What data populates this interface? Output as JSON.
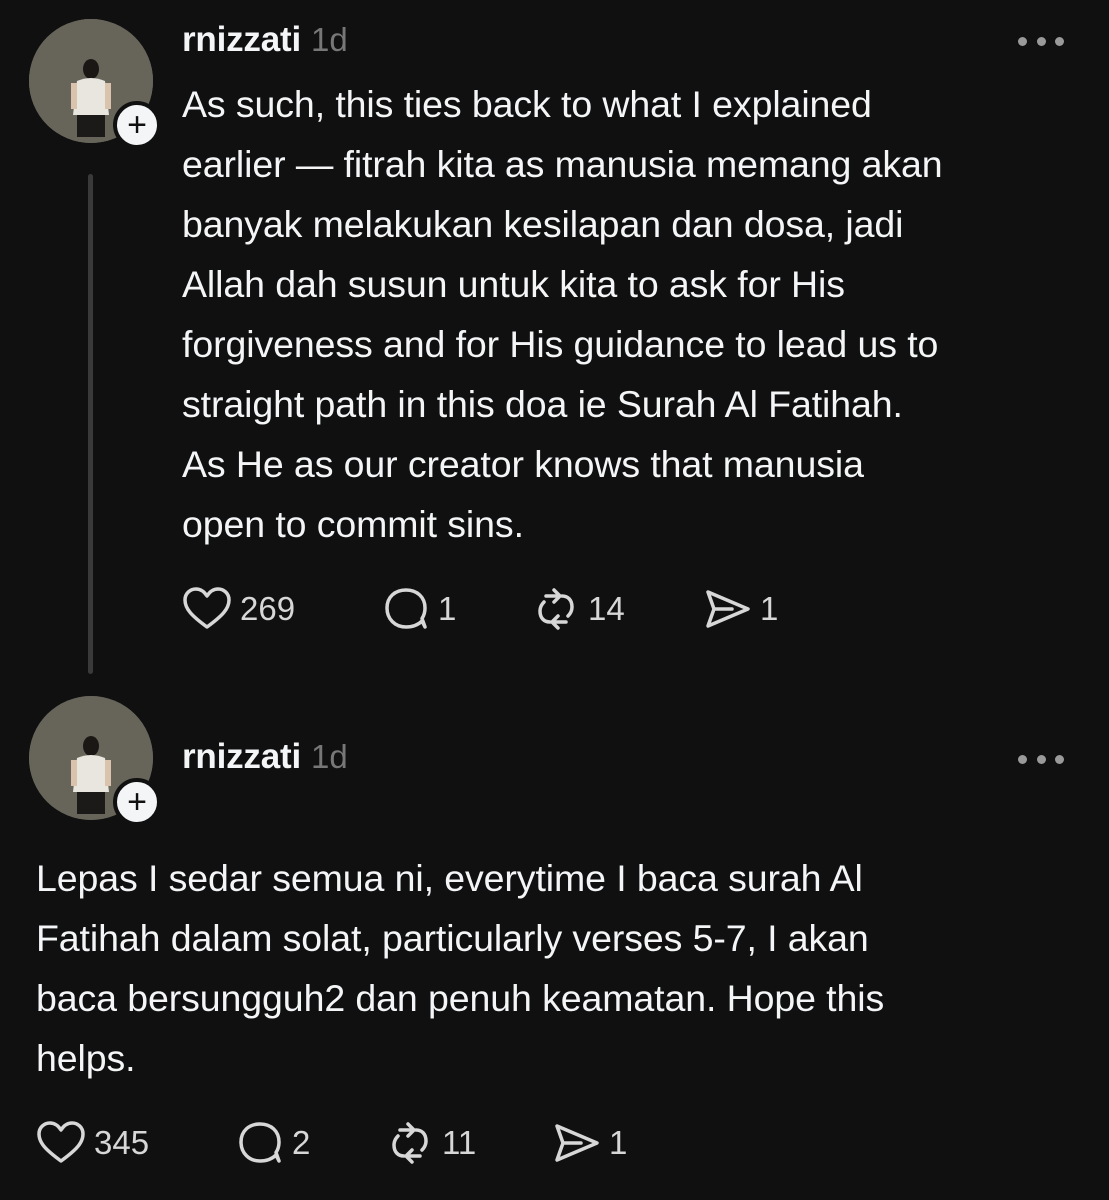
{
  "posts": [
    {
      "username": "rnizzati",
      "time": "1d",
      "text": "As such, this ties back to what I explained\nearlier — fitrah kita as manusia memang akan\nbanyak melakukan kesilapan dan dosa, jadi\nAllah dah susun untuk kita to ask for His\nforgiveness and for His guidance to lead us to\nstraight path in this doa ie Surah Al Fatihah.\nAs He as our creator knows that manusia\nopen to commit sins.",
      "likes": "269",
      "replies": "1",
      "reposts": "14",
      "shares": "1"
    },
    {
      "username": "rnizzati",
      "time": "1d",
      "text": "Lepas I sedar semua ni, everytime I baca surah Al\nFatihah dalam solat, particularly verses 5-7, I akan\nbaca bersungguh2 dan penuh keamatan. Hope this\nhelps.",
      "likes": "345",
      "replies": "2",
      "reposts": "11",
      "shares": "1"
    }
  ],
  "icons": {
    "like": "heart-icon",
    "reply": "comment-icon",
    "repost": "repost-icon",
    "share": "send-icon",
    "more": "more-dots-icon",
    "follow": "plus-icon"
  },
  "colors": {
    "background": "#101010",
    "text": "#f3f5f7",
    "muted": "#777777"
  }
}
